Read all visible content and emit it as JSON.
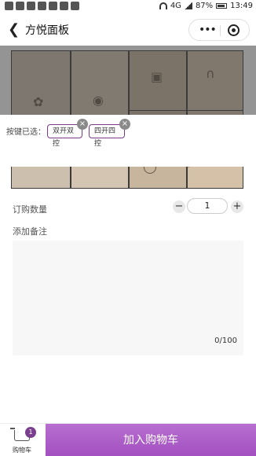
{
  "status": {
    "battery": "87%",
    "time": "13:49",
    "network": "4G"
  },
  "nav": {
    "title": "方悦面板",
    "more": "•••"
  },
  "selection": {
    "label": "按键已选：",
    "chips": [
      "双开双控",
      "四开四控"
    ],
    "remove": "×"
  },
  "quantity": {
    "label": "订购数量",
    "value": "1",
    "minus": "−",
    "plus": "+"
  },
  "note": {
    "label": "添加备注",
    "counter": "0/100"
  },
  "bottom": {
    "cart_label": "购物车",
    "cart_count": "1",
    "add_label": "加入购物车"
  },
  "colors": {
    "accent": "#a24fc0",
    "chip_border": "#7a3a8a",
    "badge": "#7b3f8f"
  }
}
